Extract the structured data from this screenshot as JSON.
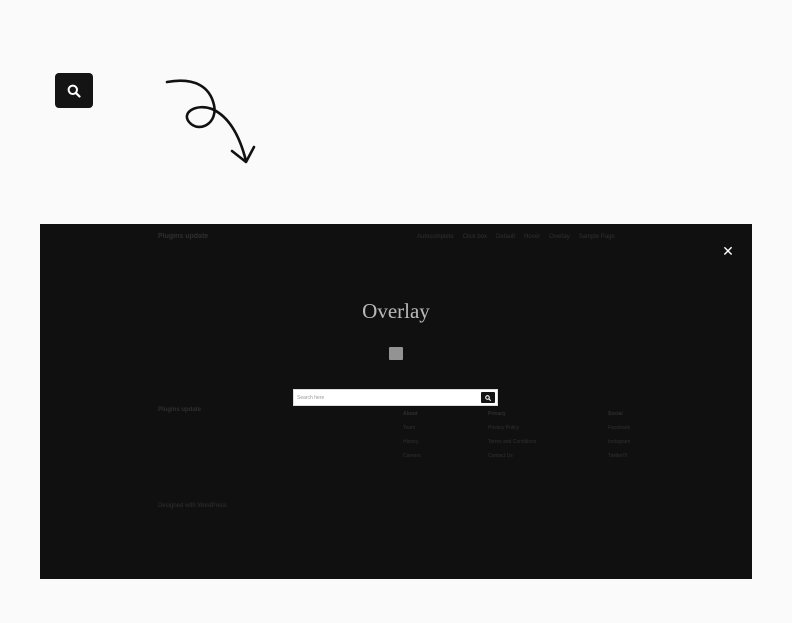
{
  "search_button": {
    "icon": "search-icon"
  },
  "annotation": {
    "icon": "curly-arrow-icon"
  },
  "preview": {
    "site_title": "Plugins update",
    "nav": [
      "Autocomplete",
      "Click box",
      "Default",
      "Hover",
      "Overlay",
      "Sample Page"
    ],
    "hero_title": "Overlay",
    "footer": {
      "brand": "Plugins update",
      "about": {
        "heading": "About",
        "items": [
          "Team",
          "History",
          "Careers"
        ]
      },
      "privacy": {
        "heading": "Privacy",
        "items": [
          "Privacy Policy",
          "Terms and Conditions",
          "Contact Us"
        ]
      },
      "social": {
        "heading": "Social",
        "items": [
          "Facebook",
          "Instagram",
          "Twitter/X"
        ]
      },
      "powered_prefix": "Designed with",
      "powered_link": "WordPress"
    },
    "close_icon": "close-icon",
    "overlay_search": {
      "placeholder": "Search here",
      "value": "",
      "button_icon": "search-icon"
    }
  },
  "colors": {
    "dark": "#141414",
    "overlay": "#101010",
    "background": "#fafafa"
  }
}
